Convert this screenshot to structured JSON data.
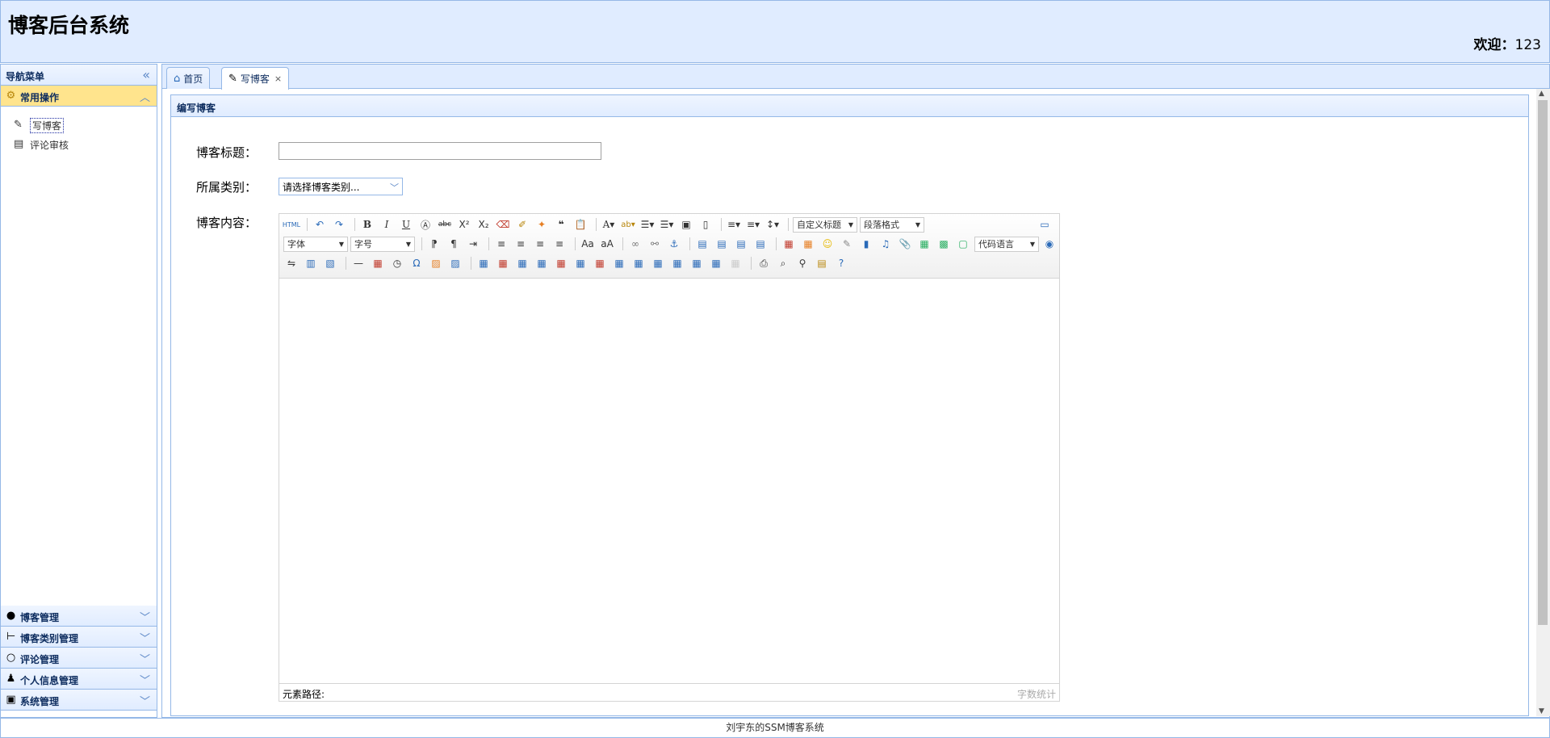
{
  "header": {
    "title": "博客后台系统",
    "welcome_label": "欢迎：",
    "username": "123"
  },
  "nav": {
    "title": "导航菜单",
    "active_section": {
      "label": "常用操作",
      "items": [
        {
          "label": "写博客"
        },
        {
          "label": "评论审核"
        }
      ]
    },
    "sections": [
      {
        "label": "博客管理"
      },
      {
        "label": "博客类别管理"
      },
      {
        "label": "评论管理"
      },
      {
        "label": "个人信息管理"
      },
      {
        "label": "系统管理"
      }
    ]
  },
  "tabs": [
    {
      "label": "首页"
    },
    {
      "label": "写博客",
      "close": "×"
    }
  ],
  "panel": {
    "title": "编写博客",
    "form": {
      "title_label": "博客标题：",
      "title_value": "",
      "type_label": "所属类别：",
      "type_value": "请选择博客类别...",
      "content_label": "博客内容："
    }
  },
  "editor": {
    "custom_title_combo": "自定义标题",
    "paragraph_combo": "段落格式",
    "font_combo": "字体",
    "size_combo": "字号",
    "code_combo": "代码语言",
    "path_label": "元素路径:",
    "count_label": "字数统计"
  },
  "footer": {
    "text": "刘宇东的SSM博客系统"
  }
}
